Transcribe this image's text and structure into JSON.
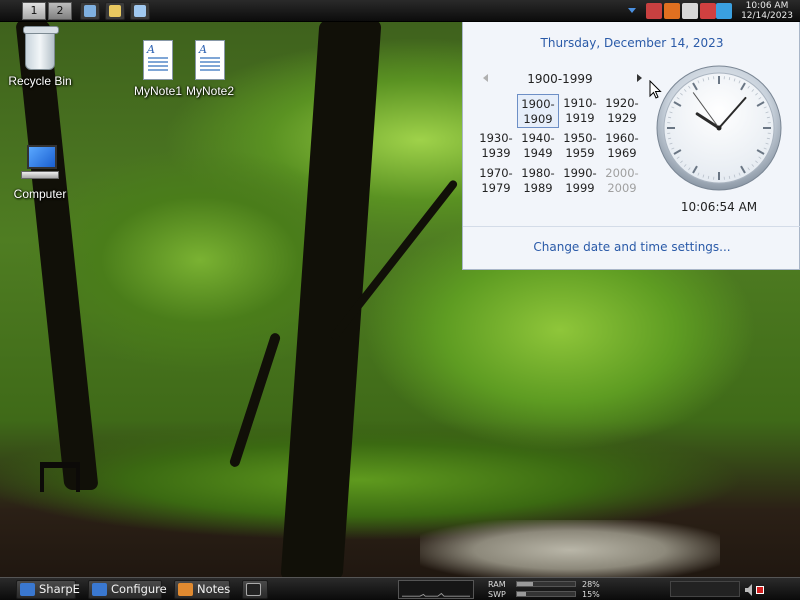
{
  "top_bar": {
    "workspaces": [
      "1",
      "2"
    ],
    "quicklaunch": [
      {
        "name": "text-editor-icon",
        "color": "#7fb0e0"
      },
      {
        "name": "file-manager-icon",
        "color": "#e8c860"
      },
      {
        "name": "desktop-icon",
        "color": "#a0c8f0"
      }
    ],
    "tray": [
      {
        "name": "network-disconnected-icon",
        "color": "#c84040"
      },
      {
        "name": "search-icon",
        "color": "#e07020"
      },
      {
        "name": "display-icon",
        "color": "#d8d8d8"
      },
      {
        "name": "volume-muted-icon",
        "color": "#d04040"
      },
      {
        "name": "app-blue-icon",
        "color": "#3aa0e0"
      }
    ],
    "time": "10:06 AM",
    "date": "12/14/2023"
  },
  "desktop": {
    "icons": [
      {
        "id": "recycle-bin",
        "label": "Recycle Bin"
      },
      {
        "id": "mynote1",
        "label": "MyNote1"
      },
      {
        "id": "mynote2",
        "label": "MyNote2"
      },
      {
        "id": "computer",
        "label": "Computer"
      }
    ]
  },
  "popup": {
    "long_date": "Thursday, December 14, 2023",
    "range": "1900-1999",
    "decades": [
      {
        "a": "1900-",
        "b": "1909",
        "state": "selected"
      },
      {
        "a": "1910-",
        "b": "1919",
        "state": "normal"
      },
      {
        "a": "1920-",
        "b": "1929",
        "state": "normal"
      },
      {
        "a": "1930-",
        "b": "1939",
        "state": "normal"
      },
      {
        "a": "1940-",
        "b": "1949",
        "state": "normal"
      },
      {
        "a": "1950-",
        "b": "1959",
        "state": "normal"
      },
      {
        "a": "1960-",
        "b": "1969",
        "state": "normal"
      },
      {
        "a": "1970-",
        "b": "1979",
        "state": "normal"
      },
      {
        "a": "1980-",
        "b": "1989",
        "state": "normal"
      },
      {
        "a": "1990-",
        "b": "1999",
        "state": "normal"
      },
      {
        "a": "2000-",
        "b": "2009",
        "state": "outside"
      }
    ],
    "clock": {
      "hour": 10,
      "minute": 6,
      "second": 54
    },
    "digital_time": "10:06:54 AM",
    "settings_link": "Change date and time settings..."
  },
  "bottom_bar": {
    "tasks": [
      {
        "id": "sharpe",
        "label": "SharpE",
        "icon": "monitor-icon",
        "color": "#3a78d0"
      },
      {
        "id": "configure",
        "label": "Configure",
        "icon": "configure-icon",
        "color": "#3a78d0"
      },
      {
        "id": "notes",
        "label": "Notes",
        "icon": "notes-icon",
        "color": "#e08a30"
      },
      {
        "id": "terminal",
        "label": "",
        "icon": "terminal-icon",
        "color": "#222222"
      }
    ],
    "ram_label": "RAM",
    "swp_label": "SWP",
    "ram_percent": 28,
    "swp_percent": 15,
    "ram_text": "28%",
    "swp_text": "15%"
  }
}
